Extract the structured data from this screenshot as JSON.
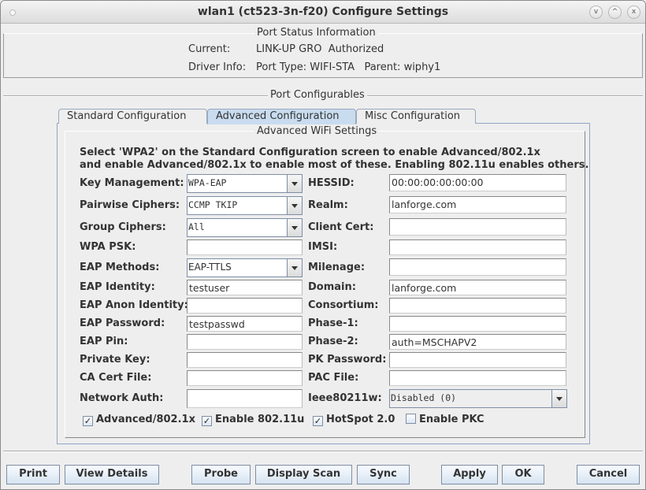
{
  "window": {
    "title": "wlan1  (ct523-3n-f20) Configure Settings",
    "controls": {
      "minimize": "v",
      "maximize": "^",
      "close": "x"
    }
  },
  "status": {
    "title": "Port Status Information",
    "current_label": "Current:",
    "current_value": "LINK-UP GRO  Authorized",
    "driver_label": "Driver Info:",
    "driver_value": "Port Type: WIFI-STA   Parent: wiphy1"
  },
  "configurables": {
    "title": "Port Configurables",
    "tabs": [
      {
        "label": "Standard Configuration",
        "active": false
      },
      {
        "label": "Advanced Configuration",
        "active": true
      },
      {
        "label": "Misc Configuration",
        "active": false
      }
    ]
  },
  "advanced": {
    "title": "Advanced WiFi Settings",
    "instructions": [
      "Select 'WPA2' on the Standard Configuration screen to enable Advanced/802.1x",
      "and enable Advanced/802.1x to enable most of these. Enabling 802.11u enables others."
    ],
    "left": [
      {
        "label": "Key Management:",
        "type": "combo",
        "value": "WPA-EAP"
      },
      {
        "label": "Pairwise Ciphers:",
        "type": "combo",
        "value": "CCMP TKIP"
      },
      {
        "label": "Group Ciphers:",
        "type": "combo",
        "value": "All"
      },
      {
        "label": "WPA PSK:",
        "type": "text",
        "value": ""
      },
      {
        "label": "EAP Methods:",
        "type": "combo",
        "value": "EAP-TTLS"
      },
      {
        "label": "EAP Identity:",
        "type": "text",
        "value": "testuser"
      },
      {
        "label": "EAP Anon Identity:",
        "type": "text",
        "value": ""
      },
      {
        "label": "EAP Password:",
        "type": "text",
        "value": "testpasswd"
      },
      {
        "label": "EAP Pin:",
        "type": "text",
        "value": ""
      },
      {
        "label": "Private Key:",
        "type": "text",
        "value": ""
      },
      {
        "label": "CA Cert File:",
        "type": "text",
        "value": ""
      },
      {
        "label": "Network Auth:",
        "type": "text",
        "value": ""
      }
    ],
    "right": [
      {
        "label": "HESSID:",
        "type": "text",
        "value": "00:00:00:00:00:00"
      },
      {
        "label": "Realm:",
        "type": "text",
        "value": "lanforge.com"
      },
      {
        "label": "Client Cert:",
        "type": "text",
        "value": ""
      },
      {
        "label": "IMSI:",
        "type": "text",
        "value": ""
      },
      {
        "label": "Milenage:",
        "type": "text",
        "value": ""
      },
      {
        "label": "Domain:",
        "type": "text",
        "value": "lanforge.com"
      },
      {
        "label": "Consortium:",
        "type": "text",
        "value": ""
      },
      {
        "label": "Phase-1:",
        "type": "text",
        "value": ""
      },
      {
        "label": "Phase-2:",
        "type": "text",
        "value": "auth=MSCHAPV2"
      },
      {
        "label": "PK Password:",
        "type": "text",
        "value": ""
      },
      {
        "label": "PAC File:",
        "type": "text",
        "value": ""
      },
      {
        "label": "Ieee80211w:",
        "type": "combo",
        "value": "Disabled (0)"
      }
    ],
    "checkboxes": [
      {
        "label": "Advanced/802.1x",
        "checked": true
      },
      {
        "label": "Enable 802.11u",
        "checked": true
      },
      {
        "label": "HotSpot 2.0",
        "checked": true
      },
      {
        "label": "Enable PKC",
        "checked": false
      }
    ]
  },
  "buttons": {
    "print": "Print",
    "view_details": "View Details",
    "probe": "Probe",
    "display_scan": "Display Scan",
    "sync": "Sync",
    "apply": "Apply",
    "ok": "OK",
    "cancel": "Cancel"
  }
}
